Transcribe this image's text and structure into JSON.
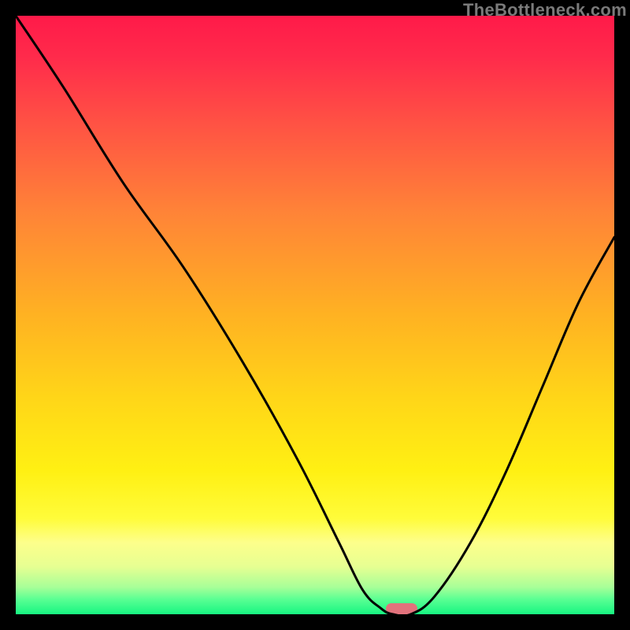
{
  "watermark": "TheBottleneck.com",
  "colors": {
    "frame_bg": "#000000",
    "marker": "#e2727c",
    "curve": "#000000",
    "gradient_top": "#ff1a49",
    "gradient_bottom": "#17f581"
  },
  "chart_data": {
    "type": "line",
    "title": "",
    "xlabel": "",
    "ylabel": "",
    "xlim": [
      0,
      100
    ],
    "ylim": [
      0,
      100
    ],
    "grid": false,
    "legend": false,
    "annotations": [
      "TheBottleneck.com"
    ],
    "series": [
      {
        "name": "bottleneck-curve",
        "x": [
          0,
          8,
          18,
          28,
          38,
          47,
          54,
          58,
          61,
          63,
          66,
          70,
          76,
          82,
          88,
          94,
          100
        ],
        "values": [
          100,
          88,
          72,
          58,
          42,
          26,
          12,
          4,
          1,
          0,
          0,
          3,
          12,
          24,
          38,
          52,
          63
        ]
      }
    ],
    "marker": {
      "x_center": 64.5,
      "y": 0,
      "width_pct": 5.3
    },
    "background_gradient": {
      "orientation": "vertical",
      "stops": [
        {
          "pos": 0.0,
          "color": "#ff1a49"
        },
        {
          "pos": 0.07,
          "color": "#ff2b4b"
        },
        {
          "pos": 0.18,
          "color": "#ff5244"
        },
        {
          "pos": 0.33,
          "color": "#ff8437"
        },
        {
          "pos": 0.5,
          "color": "#ffb222"
        },
        {
          "pos": 0.64,
          "color": "#ffd618"
        },
        {
          "pos": 0.76,
          "color": "#fff013"
        },
        {
          "pos": 0.84,
          "color": "#fffc3a"
        },
        {
          "pos": 0.88,
          "color": "#fdff8b"
        },
        {
          "pos": 0.92,
          "color": "#e7ff92"
        },
        {
          "pos": 0.955,
          "color": "#a7ff98"
        },
        {
          "pos": 0.975,
          "color": "#5aff93"
        },
        {
          "pos": 1.0,
          "color": "#17f581"
        }
      ]
    }
  }
}
